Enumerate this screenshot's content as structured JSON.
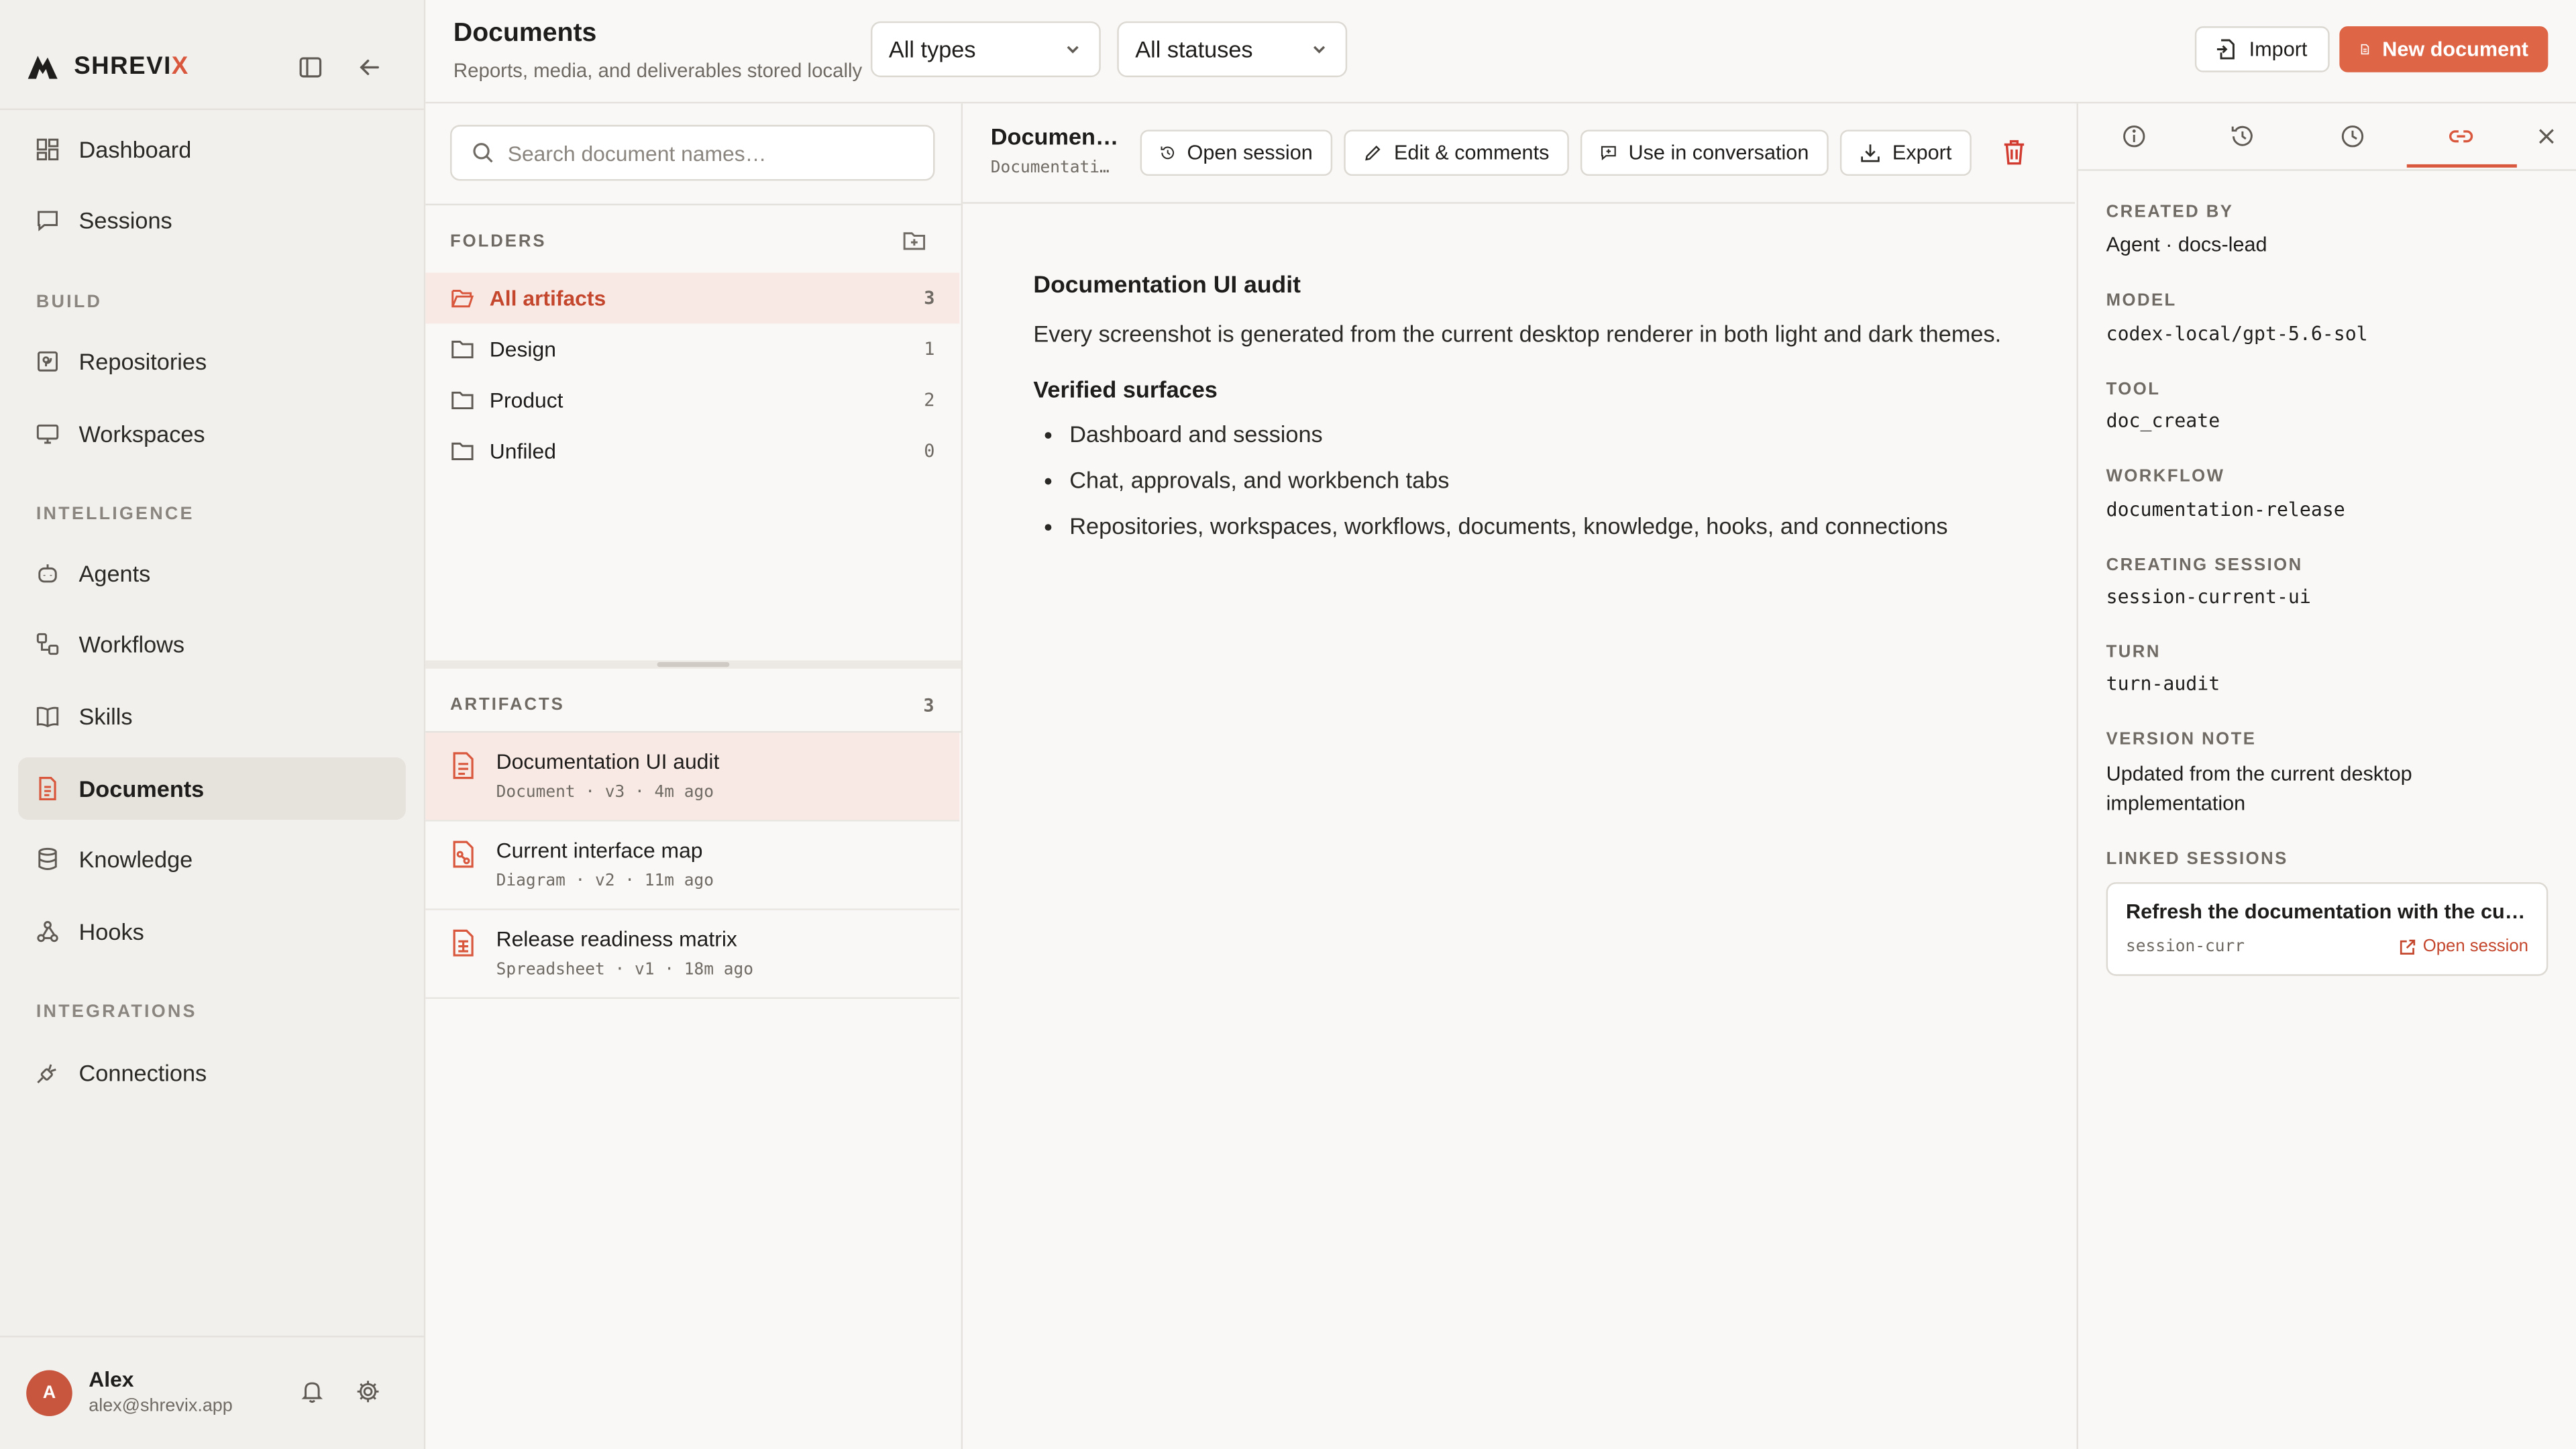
{
  "brand": {
    "name_main": "SHREVI",
    "name_accent": "X"
  },
  "sidebar": {
    "items": [
      {
        "label": "Dashboard"
      },
      {
        "label": "Sessions"
      },
      {
        "label": "Repositories"
      },
      {
        "label": "Workspaces"
      },
      {
        "label": "Agents"
      },
      {
        "label": "Workflows"
      },
      {
        "label": "Skills"
      },
      {
        "label": "Documents",
        "active": true
      },
      {
        "label": "Knowledge"
      },
      {
        "label": "Hooks"
      },
      {
        "label": "Connections"
      }
    ],
    "sections": {
      "build": "BUILD",
      "intelligence": "INTELLIGENCE",
      "integrations": "INTEGRATIONS"
    },
    "user": {
      "initial": "A",
      "name": "Alex",
      "email": "alex@shrevix.app"
    }
  },
  "header": {
    "title": "Documents",
    "subtitle": "Reports, media, and deliverables stored locally",
    "type_filter": "All types",
    "status_filter": "All statuses",
    "import_label": "Import",
    "new_label": "New document"
  },
  "left": {
    "search_placeholder": "Search document names…",
    "folders_heading": "FOLDERS",
    "folders": [
      {
        "name": "All artifacts",
        "count": "3"
      },
      {
        "name": "Design",
        "count": "1"
      },
      {
        "name": "Product",
        "count": "2"
      },
      {
        "name": "Unfiled",
        "count": "0"
      }
    ],
    "artifacts_heading": "ARTIFACTS",
    "artifacts_count": "3",
    "artifacts": [
      {
        "name": "Documentation UI audit",
        "meta": "Document · v3 · 4m ago"
      },
      {
        "name": "Current interface map",
        "meta": "Diagram · v2 · 11m ago"
      },
      {
        "name": "Release readiness matrix",
        "meta": "Spreadsheet · v1 · 18m ago"
      }
    ]
  },
  "center": {
    "doc_title": "Documentation UI audit",
    "doc_sub": "Documentation UI audit",
    "toolbar": {
      "open_session": "Open session",
      "edit": "Edit & comments",
      "use": "Use in conversation",
      "export": "Export"
    },
    "body": {
      "heading": "Documentation UI audit",
      "paragraph": "Every screenshot is generated from the current desktop renderer in both light and dark themes.",
      "subheading": "Verified surfaces",
      "bullets": [
        "Dashboard and sessions",
        "Chat, approvals, and workbench tabs",
        "Repositories, workspaces, workflows, documents, knowledge, hooks, and connections"
      ]
    }
  },
  "right": {
    "created_by_label": "CREATED BY",
    "created_by": "Agent · docs-lead",
    "model_label": "MODEL",
    "model": "codex-local/gpt-5.6-sol",
    "tool_label": "TOOL",
    "tool": "doc_create",
    "workflow_label": "WORKFLOW",
    "workflow": "documentation-release",
    "session_label": "CREATING SESSION",
    "session": "session-current-ui",
    "turn_label": "TURN",
    "turn": "turn-audit",
    "version_label": "VERSION NOTE",
    "version": "Updated from the current desktop implementation",
    "linked_label": "LINKED SESSIONS",
    "linked": {
      "title": "Refresh the documentation with the current UI",
      "session": "session-curr",
      "open": "Open session"
    }
  },
  "colors": {
    "accent": "#de6546",
    "accent_text": "#c4472d",
    "active_bg": "#f8e9e4"
  }
}
